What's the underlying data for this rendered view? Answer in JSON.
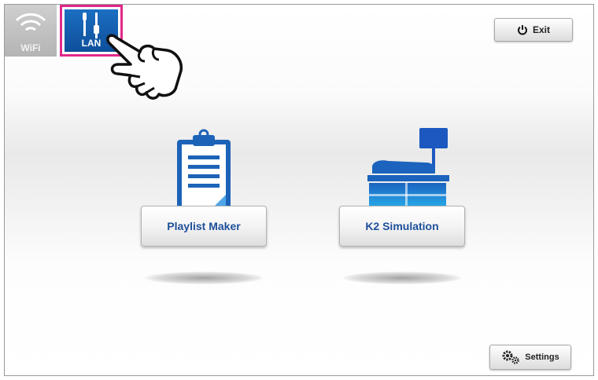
{
  "network_tabs": {
    "wifi_label": "WiFi",
    "lan_label": "LAN"
  },
  "header": {
    "exit_label": "Exit"
  },
  "apps": {
    "playlist_maker_label": "Playlist Maker",
    "k2_simulation_label": "K2 Simulation"
  },
  "footer": {
    "settings_label": "Settings"
  },
  "colors": {
    "lan_blue": "#1b6fc2",
    "highlight_pink": "#e0288a",
    "app_label_blue": "#1d4f9a"
  }
}
